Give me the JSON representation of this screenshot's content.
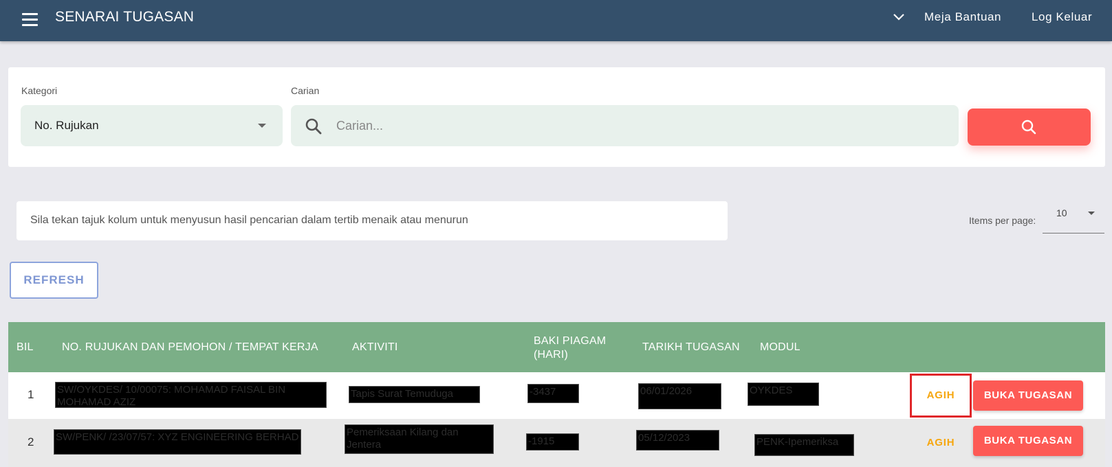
{
  "header": {
    "title": "SENARAI TUGASAN",
    "help_label": "Meja Bantuan",
    "logout_label": "Log Keluar"
  },
  "search": {
    "category_label": "Kategori",
    "category_value": "No. Rujukan",
    "search_label": "Carian",
    "search_placeholder": "Carian...",
    "search_value": ""
  },
  "hint": "Sila tekan tajuk kolum untuk menyusun hasil pencarian dalam tertib menaik atau menurun",
  "pagination": {
    "items_per_page_label": "Items per page:",
    "items_per_page_value": "10"
  },
  "refresh_label": "REFRESH",
  "table": {
    "columns": {
      "bil": "BIL",
      "rujukan": "NO. RUJUKAN DAN PEMOHON / TEMPAT KERJA",
      "aktiviti": "AKTIVITI",
      "baki_line1": "BAKI PIAGAM",
      "baki_line2": "(HARI)",
      "tarikh": "TARIKH TUGASAN",
      "modul": "MODUL"
    },
    "rows": [
      {
        "bil": "1",
        "rujukan": "SW/OYKDES/ 10/00075: MOHAMAD FAISAL BIN MOHAMAD AZIZ",
        "aktiviti": "Tapis Surat Temuduga",
        "baki": "-3437",
        "tarikh": "06/01/2026",
        "modul": "OYKDES",
        "agih_label": "AGIH",
        "buka_label": "BUKA TUGASAN"
      },
      {
        "bil": "2",
        "rujukan": "SW/PENK/ /23/07/57: XYZ ENGINEERING BERHAD",
        "aktiviti": "Pemeriksaan Kilang dan Jentera",
        "baki": "-1915",
        "tarikh": "05/12/2023",
        "modul": "PENK-Ipemeriksa",
        "agih_label": "AGIH",
        "buka_label": "BUKA TUGASAN"
      }
    ]
  },
  "colors": {
    "topbar": "#34506b",
    "table_header": "#7baf87",
    "accent_red": "#fd5a55",
    "agih": "#f6a60e",
    "focus_outline": "#e0262a"
  }
}
